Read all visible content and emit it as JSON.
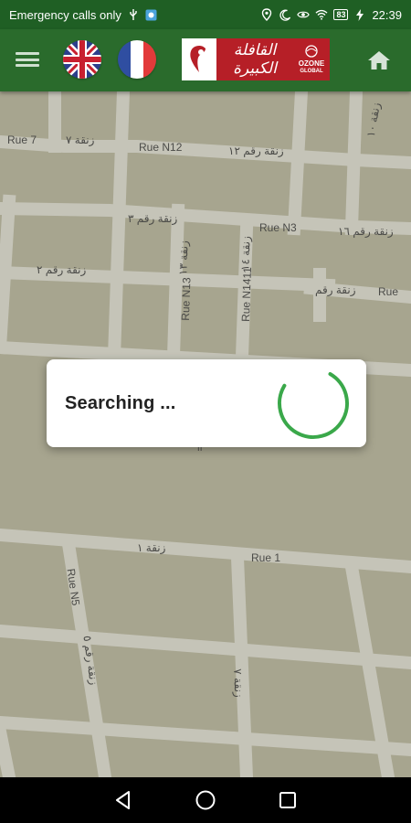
{
  "status_bar": {
    "carrier": "Emergency calls only",
    "battery": "83",
    "time": "22:39",
    "icons": [
      "usb-icon",
      "vpn-icon",
      "location-icon",
      "moon-icon",
      "eye-icon",
      "wifi-icon",
      "battery-icon",
      "charging-icon"
    ]
  },
  "app_bar": {
    "menu_icon": "hamburger-menu-icon",
    "languages": [
      "English (UK flag)",
      "Français (French flag)"
    ],
    "logo_script": "القافلة الكبيرة",
    "logo_brand": "OZONE",
    "logo_brand_sub": "GLOBAL",
    "home_icon": "home-icon",
    "colors": {
      "bar": "#2a6b2c",
      "status": "#1f5f24",
      "logo_bg": "#b61f27"
    }
  },
  "map": {
    "labels": {
      "rue7": "Rue 7",
      "z7": "زنقة ٧",
      "rueN12": "Rue N12",
      "z12": "زنقة رقم ١٢",
      "z10": "زنقة ١٠",
      "z3": "زنقة رقم ٣",
      "rueN3": "Rue N3",
      "z16": "زنقة رقم ١٦",
      "z2": "زنقة رقم ٢",
      "rueN13": "Rue N13",
      "z13": "زنقة ١٣",
      "rueN14": "Rue N1411",
      "z14": "زنقة ١٤",
      "zraqm": "زنقة رقم",
      "rue_edge": "Rue",
      "z1": "زنقة ١",
      "rue1": "Rue 1",
      "rueN5": "Rue N5",
      "z5": "زنقة رقم ٥",
      "z7b": "زنقة ٧",
      "tick": "זו"
    },
    "colors": {
      "land": "#a7a58f",
      "road": "#c7c6bb"
    }
  },
  "dialog": {
    "text": "Searching ...",
    "spinner_color": "#3aa84a"
  },
  "nav_bar": {
    "back": "back-icon",
    "home": "home-circle-icon",
    "recents": "recents-icon"
  }
}
